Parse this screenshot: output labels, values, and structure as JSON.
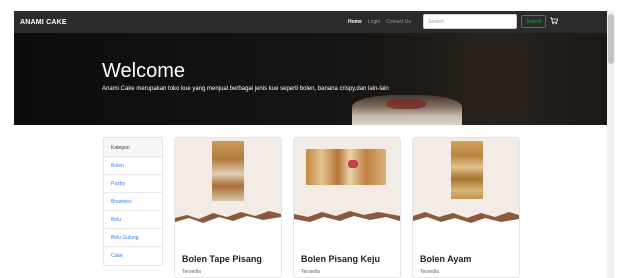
{
  "navbar": {
    "brand": "ANAMI CAKE",
    "links": [
      "Home",
      "Login",
      "Contact Us"
    ],
    "search_placeholder": "Search",
    "search_button": "Search",
    "bg_color": "#2b2b2b"
  },
  "hero": {
    "title": "Welcome",
    "text": "Anami Cake merupakan toko kue yang menjual berbagai jenis kue seperti bolen, banana crispy,dan lain-lain"
  },
  "sidebar": {
    "header": "Kategori",
    "items": [
      "Bolen",
      "Pastry",
      "Brownies",
      "Bolu",
      "Bolu Gulung",
      "Cake"
    ],
    "link_color": "#2f7ff0"
  },
  "products": [
    {
      "name": "Bolen Tape Pisang",
      "status": "Tersedia"
    },
    {
      "name": "Bolen Pisang Keju",
      "status": "Tersedia"
    },
    {
      "name": "Bolen Ayam",
      "status": "Tersedia"
    }
  ],
  "icons": {
    "cart": "shopping-cart-icon"
  }
}
